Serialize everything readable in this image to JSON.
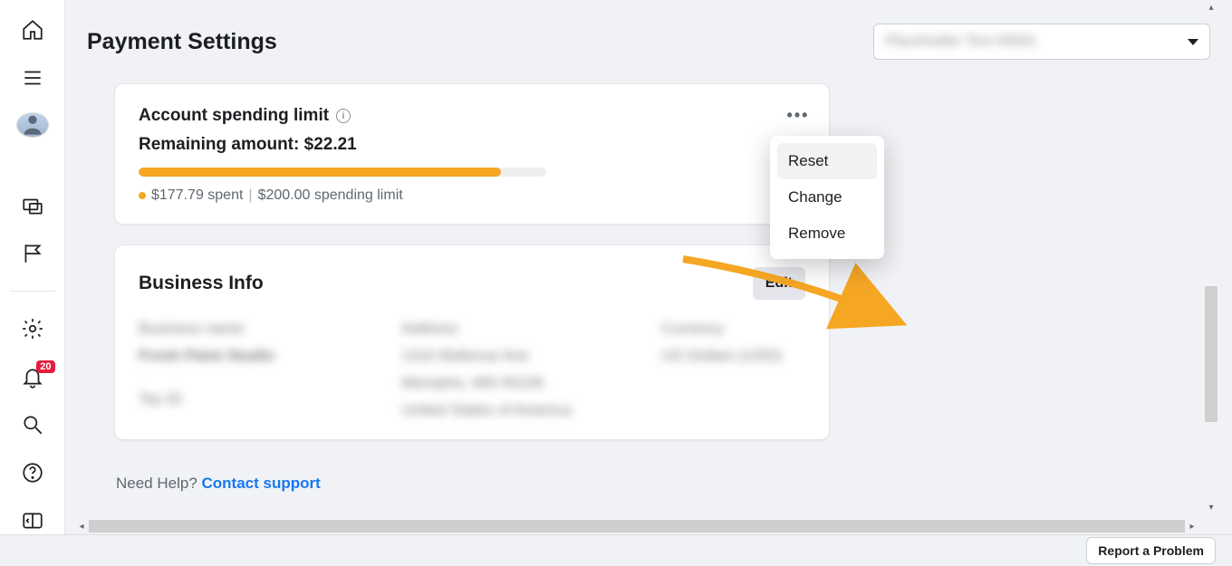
{
  "page_title": "Payment Settings",
  "account_selector": {
    "label_obscured": "Placeholder Text #0001"
  },
  "sidebar": {
    "notifications_badge": "20"
  },
  "spending_limit": {
    "title": "Account spending limit",
    "remaining_label": "Remaining amount:",
    "remaining_value": "$22.21",
    "spent_text": "$177.79 spent",
    "limit_text": "$200.00 spending limit",
    "progress_pct": 88.9,
    "menu": {
      "reset": "Reset",
      "change": "Change",
      "remove": "Remove"
    }
  },
  "business_info": {
    "title": "Business Info",
    "edit_label": "Edit"
  },
  "help": {
    "prefix": "Need Help? ",
    "link": "Contact support"
  },
  "footer": {
    "report": "Report a Problem"
  }
}
